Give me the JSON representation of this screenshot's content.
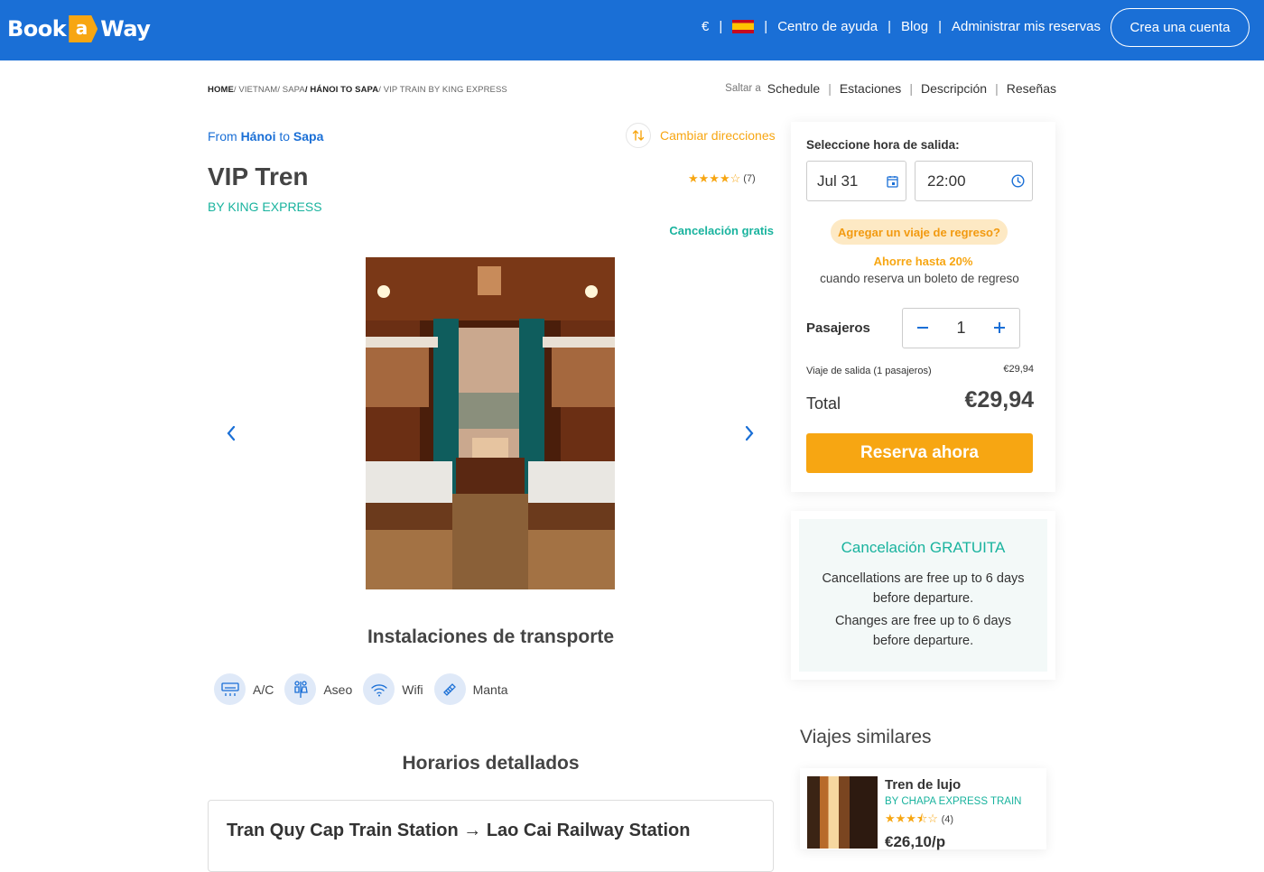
{
  "header": {
    "logo_left": "Book",
    "logo_mid": "a",
    "logo_right": "Way",
    "currency": "€",
    "help": "Centro de ayuda",
    "blog": "Blog",
    "manage": "Administrar mis reservas",
    "signup": "Crea una cuenta"
  },
  "breadcrumb": {
    "home": "HOME",
    "vietnam": "/ VIETNAM",
    "sapa": "/ SAPA",
    "route": "/ HÁNOI TO SAPA",
    "current": "/ VIP TRAIN BY KING EXPRESS"
  },
  "jump": {
    "label": "Saltar a",
    "schedule": "Schedule",
    "stations": "Estaciones",
    "description": "Descripción",
    "reviews": "Reseñas"
  },
  "trip": {
    "from_word": "From",
    "from_city": "Hánoi",
    "to_word": "to",
    "to_city": "Sapa",
    "swap_label": "Cambiar direcciones",
    "title": "VIP Tren",
    "operator": "BY KING EXPRESS",
    "stars": "★★★★☆",
    "rating_count": "(7)",
    "free_cancel": "Cancelación gratis"
  },
  "facilities": {
    "heading": "Instalaciones de transporte",
    "items": [
      {
        "label": "A/C",
        "icon": "ac-icon"
      },
      {
        "label": "Aseo",
        "icon": "toilet-icon"
      },
      {
        "label": "Wifi",
        "icon": "wifi-icon"
      },
      {
        "label": "Manta",
        "icon": "blanket-icon"
      }
    ]
  },
  "schedule": {
    "heading": "Horarios detallados",
    "route": "Tran Quy Cap Train Station → Lao Cai Railway Station"
  },
  "booking": {
    "select_label": "Seleccione hora de salida:",
    "date": "Jul 31",
    "time": "22:00",
    "return_pill": "Agregar un viaje de regreso?",
    "save_line1": "Ahorre hasta 20%",
    "save_line2": "cuando reserva un boleto de regreso",
    "passengers_label": "Pasajeros",
    "passengers": "1",
    "outbound_label": "Viaje de salida (1 pasajeros)",
    "outbound_price": "€29,94",
    "total_label": "Total",
    "total_value": "€29,94",
    "reserve": "Reserva ahora"
  },
  "cancellation": {
    "heading": "Cancelación GRATUITA",
    "line1": "Cancellations are free up to 6 days before departure.",
    "line2": "Changes are free up to 6 days before departure."
  },
  "similar": {
    "heading": "Viajes similares",
    "name": "Tren de lujo",
    "operator": "BY CHAPA EXPRESS TRAIN",
    "stars": "★★★⯪☆",
    "rating_count": "(4)",
    "price": "€26,10/p"
  },
  "colors": {
    "brand_blue": "#1a6fd6",
    "accent_orange": "#f7a612",
    "teal": "#19b39e"
  }
}
